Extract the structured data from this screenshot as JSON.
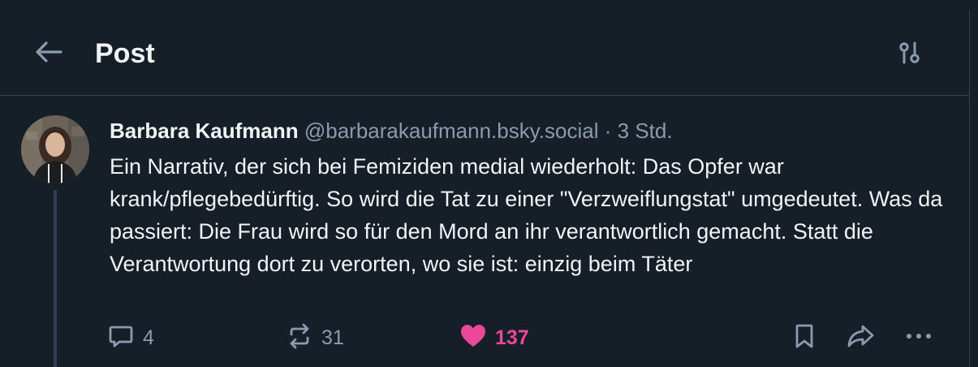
{
  "header": {
    "title": "Post",
    "back_icon": "arrow-left-icon",
    "settings_icon": "sliders-icon"
  },
  "post": {
    "author_name": "Barbara Kaufmann",
    "author_handle": "@barbarakaufmann.bsky.social",
    "separator": "·",
    "time": "3 Std.",
    "text": "Ein Narrativ, der sich bei Femiziden medial wiederholt: Das Opfer war krank/pflegebedürftig. So wird die Tat zu einer \"Verzweiflungstat\" umgedeutet. Was da passiert: Die Frau wird so für den Mord an ihr verantwortlich gemacht. Statt die Verantwortung dort zu verorten, wo sie ist: einzig beim Täter",
    "actions": {
      "reply_count": "4",
      "repost_count": "31",
      "like_count": "137",
      "liked": true
    }
  },
  "colors": {
    "background": "#161e27",
    "border": "#2e4052",
    "text": "#f1f3f5",
    "muted": "#8a9bb0",
    "like": "#ec4899"
  }
}
